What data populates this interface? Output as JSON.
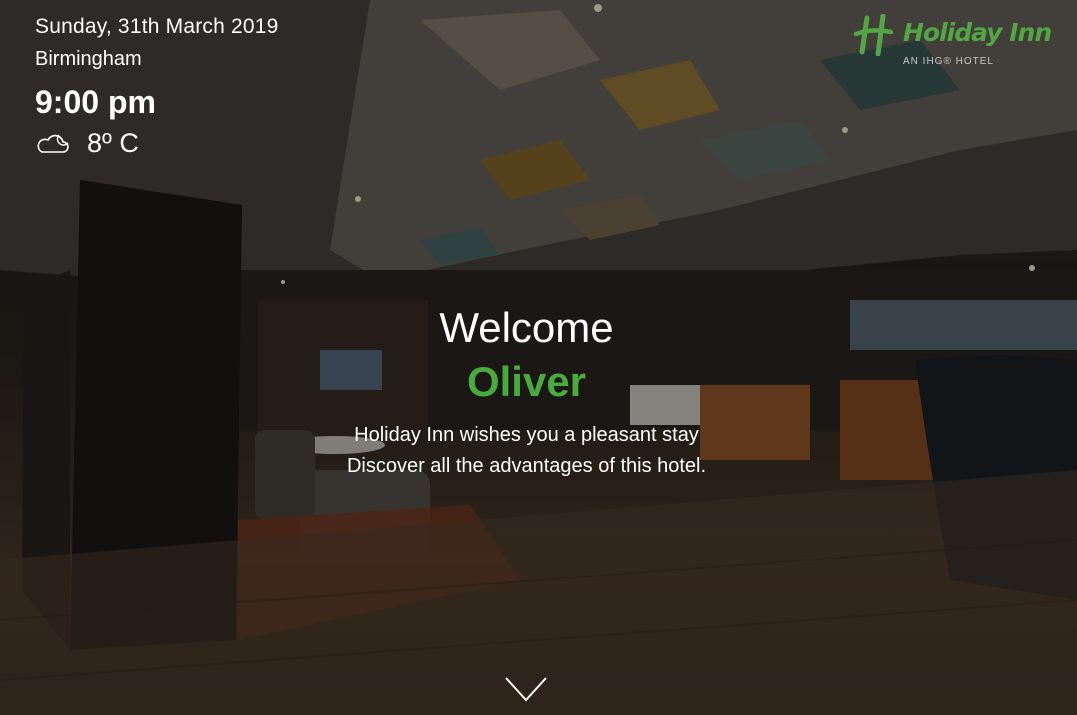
{
  "info": {
    "date": "Sunday, 31th March 2019",
    "city": "Birmingham",
    "time": "9:00 pm",
    "temperature": "8º C",
    "weather_icon": "cloudy-night-icon"
  },
  "logo": {
    "name": "Holiday Inn",
    "tagline": "AN IHG® HOTEL",
    "brand_color": "#52a644"
  },
  "welcome": {
    "heading": "Welcome",
    "guest_name": "Oliver",
    "line_1": "Holiday Inn wishes you a pleasant stay",
    "line_2": "Discover all the advantages of this hotel.",
    "accent_color": "#4aab3d"
  },
  "scroll": {
    "icon": "chevron-down-icon"
  }
}
